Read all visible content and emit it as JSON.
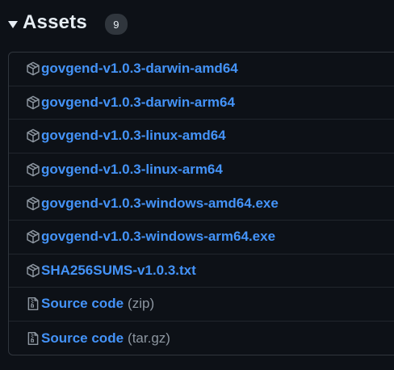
{
  "header": {
    "title": "Assets",
    "count": "9"
  },
  "assets": [
    {
      "name": "govgend-v1.0.3-darwin-amd64",
      "icon": "package-icon",
      "suffix": ""
    },
    {
      "name": "govgend-v1.0.3-darwin-arm64",
      "icon": "package-icon",
      "suffix": ""
    },
    {
      "name": "govgend-v1.0.3-linux-amd64",
      "icon": "package-icon",
      "suffix": ""
    },
    {
      "name": "govgend-v1.0.3-linux-arm64",
      "icon": "package-icon",
      "suffix": ""
    },
    {
      "name": "govgend-v1.0.3-windows-amd64.exe",
      "icon": "package-icon",
      "suffix": ""
    },
    {
      "name": "govgend-v1.0.3-windows-arm64.exe",
      "icon": "package-icon",
      "suffix": ""
    },
    {
      "name": "SHA256SUMS-v1.0.3.txt",
      "icon": "package-icon",
      "suffix": ""
    },
    {
      "name": "Source code",
      "icon": "file-zip-icon",
      "suffix": "(zip)"
    },
    {
      "name": "Source code",
      "icon": "file-zip-icon",
      "suffix": "(tar.gz)"
    }
  ],
  "colors": {
    "background": "#0d1117",
    "link": "#4493f8",
    "muted": "#8d96a0",
    "border": "#30363d",
    "text": "#e6edf3"
  }
}
